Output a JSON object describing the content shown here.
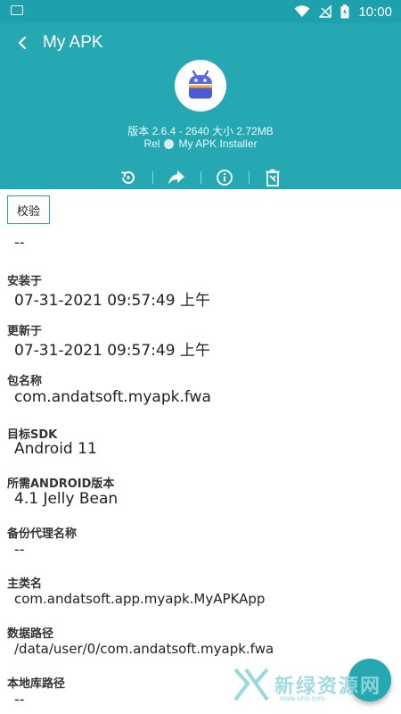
{
  "status_bar": {
    "time": "10:00",
    "battery_icon": "battery-charging-icon",
    "wifi_icon": "wifi-icon",
    "signal_icon": "signal-icon",
    "notification_icon": "image-icon"
  },
  "header": {
    "title": "My APK",
    "back_icon": "chevron-left-icon",
    "app_icon": "android-icon",
    "version_line": "版本 2.6.4 - 2640 大小 2.72MB",
    "release_prefix": "Rel",
    "installer": "My APK Installer",
    "toolbar": [
      {
        "name": "restore-icon"
      },
      {
        "name": "share-icon"
      },
      {
        "name": "info-icon"
      },
      {
        "name": "uninstall-icon"
      }
    ],
    "accent": "#26a8b3"
  },
  "verify_button": "校验",
  "verify_value": "--",
  "details": [
    {
      "label": "安装于",
      "value": "07-31-2021 09:57:49 上午"
    },
    {
      "label": "更新于",
      "value": "07-31-2021 09:57:49 上午"
    },
    {
      "label": "包名称",
      "value": "com.andatsoft.myapk.fwa"
    },
    {
      "label": "目标SDK",
      "value": "Android 11"
    },
    {
      "label": "所需ANDROID版本",
      "value": "4.1 Jelly Bean"
    },
    {
      "label": "备份代理名称",
      "value": "--"
    },
    {
      "label": "主类名",
      "value": "com.andatsoft.app.myapk.MyAPKApp"
    },
    {
      "label": "数据路径",
      "value": "/data/user/0/com.andatsoft.myapk.fwa"
    },
    {
      "label": "本地库路径",
      "value": "--"
    }
  ],
  "watermark": {
    "text": "新绿资源网",
    "sub": "www.xlhs.com"
  }
}
